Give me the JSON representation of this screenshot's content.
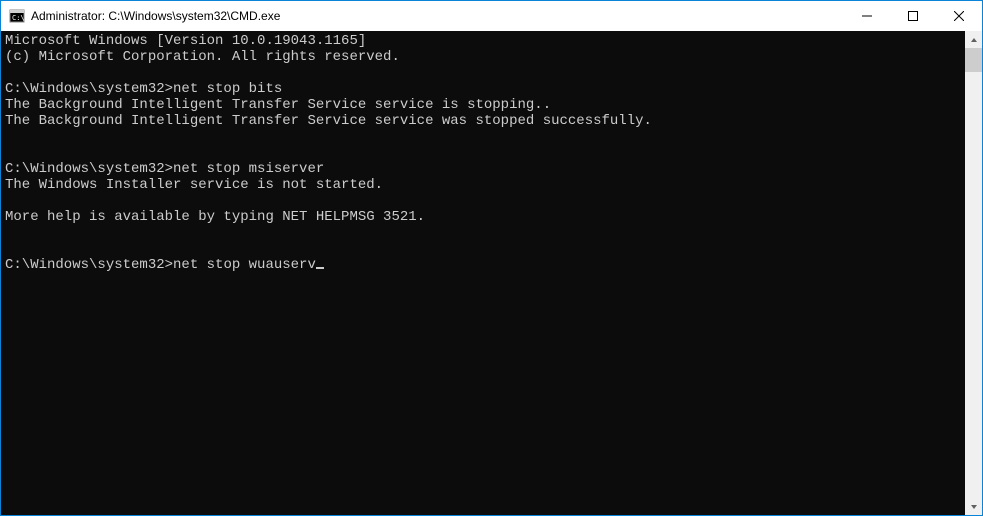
{
  "window": {
    "title": "Administrator: C:\\Windows\\system32\\CMD.exe"
  },
  "console": {
    "lines": [
      "Microsoft Windows [Version 10.0.19043.1165]",
      "(c) Microsoft Corporation. All rights reserved.",
      "",
      "C:\\Windows\\system32>net stop bits",
      "The Background Intelligent Transfer Service service is stopping..",
      "The Background Intelligent Transfer Service service was stopped successfully.",
      "",
      "",
      "C:\\Windows\\system32>net stop msiserver",
      "The Windows Installer service is not started.",
      "",
      "More help is available by typing NET HELPMSG 3521.",
      "",
      ""
    ],
    "current_prompt": "C:\\Windows\\system32>",
    "current_command": "net stop wuauserv"
  }
}
